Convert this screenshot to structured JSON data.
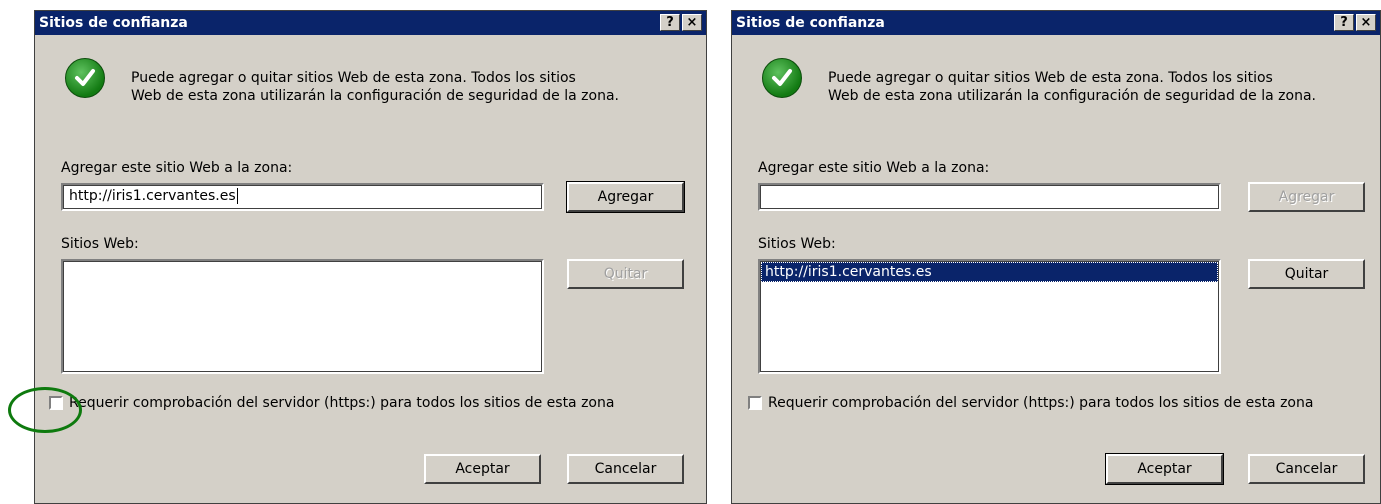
{
  "dialogs": [
    {
      "title": "Sitios de confianza",
      "help_btn": "?",
      "close_btn": "×",
      "info_line1": "Puede agregar o quitar sitios Web de esta zona.  Todos los sitios",
      "info_line2": "Web de esta zona utilizarán la configuración de seguridad de la zona.",
      "add_label": "Agregar este sitio Web a la zona:",
      "add_value": "http://iris1.cervantes.es",
      "add_button": "Agregar",
      "add_button_enabled": true,
      "sites_label": "Sitios Web:",
      "sites": [],
      "remove_button": "Quitar",
      "remove_button_enabled": false,
      "https_check_label": "Requerir comprobación del servidor (https:) para todos los sitios de esta zona",
      "https_checked": false,
      "ok_button": "Aceptar",
      "cancel_button": "Cancelar"
    },
    {
      "title": "Sitios de confianza",
      "help_btn": "?",
      "close_btn": "×",
      "info_line1": "Puede agregar o quitar sitios Web de esta zona.  Todos los sitios",
      "info_line2": "Web de esta zona utilizarán la configuración de seguridad de la zona.",
      "add_label": "Agregar este sitio Web a la zona:",
      "add_value": "",
      "add_button": "Agregar",
      "add_button_enabled": false,
      "sites_label": "Sitios Web:",
      "sites": [
        "http://iris1.cervantes.es"
      ],
      "remove_button": "Quitar",
      "remove_button_enabled": true,
      "https_check_label": "Requerir comprobación del servidor (https:) para todos los sitios de esta zona",
      "https_checked": false,
      "ok_button": "Aceptar",
      "cancel_button": "Cancelar"
    }
  ],
  "colors": {
    "titlebar": "#0a246a",
    "dialog_bg": "#d4d0c8",
    "highlight_ring": "#0e7a0e"
  },
  "icons": {
    "info": "green-check-icon"
  }
}
